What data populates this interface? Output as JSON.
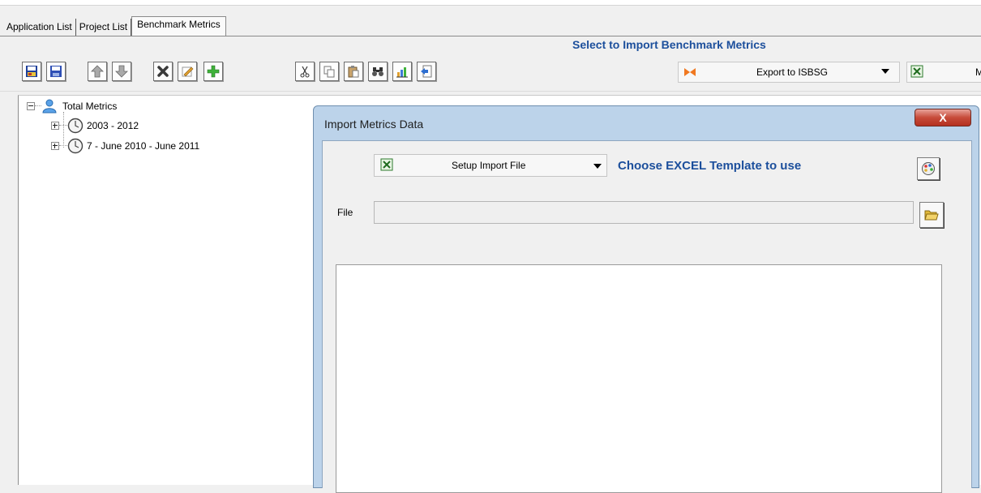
{
  "tabs": [
    {
      "label": "Application List"
    },
    {
      "label": "Project List"
    },
    {
      "label": "Benchmark Metrics"
    }
  ],
  "hint": "Select to Import Benchmark Metrics",
  "toolbar": {
    "icons": [
      "save-colored-icon",
      "save-icon",
      "move-up-icon",
      "move-down-icon",
      "delete-icon",
      "edit-icon",
      "add-icon",
      "cut-icon",
      "copy-icon",
      "paste-icon",
      "find-icon",
      "chart-icon",
      "import-icon"
    ],
    "export_label": "Export to ISBSG",
    "excel_truncated": "M"
  },
  "tree": {
    "root": "Total Metrics",
    "children": [
      {
        "label": "2003 - 2012"
      },
      {
        "label": "7 - June 2010 - June 2011"
      }
    ]
  },
  "dialog": {
    "title": "Import Metrics Data",
    "close": "X",
    "setup_label": "Setup Import File",
    "choose_text": "Choose EXCEL Template to use",
    "file_label": "File",
    "file_value": ""
  },
  "colors": {
    "accent_text": "#1c4f9c",
    "dialog_frame": "#bcd3ea",
    "close_button": "#c74b3a"
  }
}
